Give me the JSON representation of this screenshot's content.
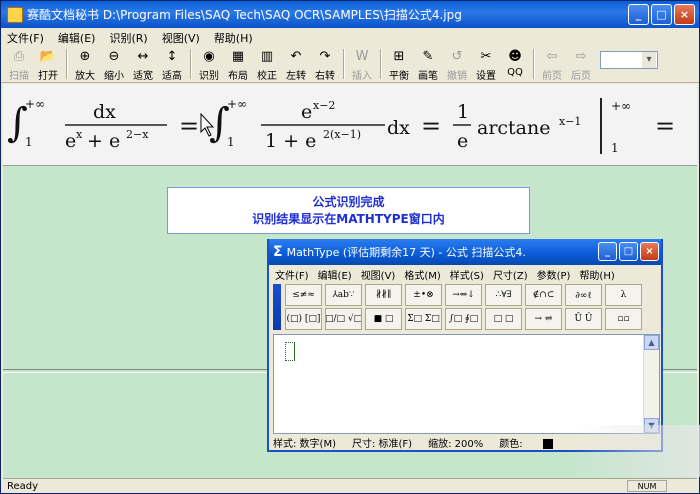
{
  "window": {
    "title": "赛酷文档秘书 D:\\Program Files\\SAQ Tech\\SAQ OCR\\SAMPLES\\扫描公式4.jpg",
    "buttons": [
      "_",
      "□",
      "×"
    ]
  },
  "menu": [
    "文件(F)",
    "编辑(E)",
    "识别(R)",
    "视图(V)",
    "帮助(H)"
  ],
  "toolbar": {
    "items": [
      {
        "label": "扫描",
        "icon": "scanner-icon",
        "glyph": "⎙",
        "disabled": true
      },
      {
        "label": "打开",
        "icon": "open-folder-icon",
        "glyph": "📂",
        "disabled": false
      },
      {
        "label": "放大",
        "icon": "zoom-in-icon",
        "glyph": "⊕",
        "disabled": false
      },
      {
        "label": "缩小",
        "icon": "zoom-out-icon",
        "glyph": "⊖",
        "disabled": false
      },
      {
        "label": "适宽",
        "icon": "fit-width-icon",
        "glyph": "↔",
        "disabled": false
      },
      {
        "label": "适高",
        "icon": "fit-height-icon",
        "glyph": "↕",
        "disabled": false
      },
      {
        "label": "识别",
        "icon": "recognize-icon",
        "glyph": "◉",
        "disabled": false
      },
      {
        "label": "布局",
        "icon": "layout-icon",
        "glyph": "▦",
        "disabled": false
      },
      {
        "label": "校正",
        "icon": "correct-icon",
        "glyph": "▥",
        "disabled": false
      },
      {
        "label": "左转",
        "icon": "rotate-left-icon",
        "glyph": "↶",
        "disabled": false
      },
      {
        "label": "右转",
        "icon": "rotate-right-icon",
        "glyph": "↷",
        "disabled": false
      },
      {
        "label": "插入",
        "icon": "insert-icon",
        "glyph": "W",
        "disabled": true
      },
      {
        "label": "平衡",
        "icon": "balance-icon",
        "glyph": "⊞",
        "disabled": false
      },
      {
        "label": "画笔",
        "icon": "pen-icon",
        "glyph": "✎",
        "disabled": false
      },
      {
        "label": "撤销",
        "icon": "undo-icon",
        "glyph": "↺",
        "disabled": true
      },
      {
        "label": "设置",
        "icon": "settings-icon",
        "glyph": "✂",
        "disabled": false
      },
      {
        "label": "QQ",
        "icon": "qq-icon",
        "glyph": "☻",
        "disabled": false
      },
      {
        "label": "前页",
        "icon": "prev-page-icon",
        "glyph": "⇦",
        "disabled": true
      },
      {
        "label": "后页",
        "icon": "next-page-icon",
        "glyph": "⇨",
        "disabled": true
      }
    ]
  },
  "notice": {
    "line1": "公式识别完成",
    "line2": "识别结果显示在MATHTYPE窗口内"
  },
  "status": {
    "text": "Ready",
    "num": "NUM"
  },
  "mathtype": {
    "title": "MathType (评估期剩余17 天) - 公式 扫描公式4.",
    "menu": [
      "文件(F)",
      "编辑(E)",
      "视图(V)",
      "格式(M)",
      "样式(S)",
      "尺寸(Z)",
      "参数(P)",
      "帮助(H)"
    ],
    "palette_row1": [
      "≤≠≈",
      "⅄ab∵",
      "∦∦∥",
      "±•⊗",
      "→⇔↓",
      "∴∀∃",
      "∉∩⊂",
      "∂∞ℓ",
      "λ"
    ],
    "palette_row2": [
      "(□) [□]",
      "□/□ √□",
      "■ □",
      "Σ□ Σ□",
      "∫□ ∮□",
      "□ □",
      "→ ⇌",
      "Ū Û",
      "▫▫"
    ],
    "status": {
      "style": "样式: 数字(M)",
      "size": "尺寸: 标准(F)",
      "zoom": "缩放: 200%",
      "color": "颜色:"
    }
  }
}
